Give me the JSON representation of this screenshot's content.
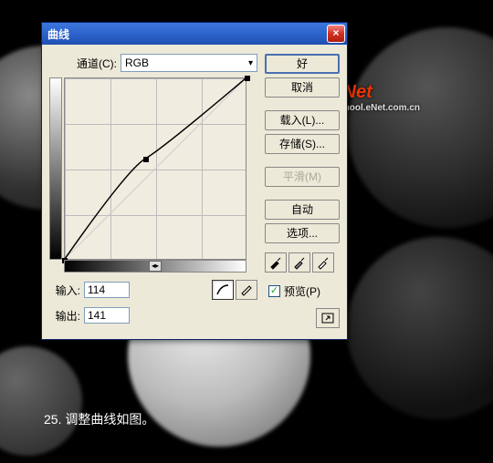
{
  "dialog": {
    "title": "曲线",
    "channel_label": "通道(C):",
    "channel_value": "RGB",
    "input_label": "输入:",
    "input_value": "114",
    "output_label": "输出:",
    "output_value": "141"
  },
  "buttons": {
    "ok": "好",
    "cancel": "取消",
    "load": "载入(L)...",
    "save": "存储(S)...",
    "smooth": "平滑(M)",
    "auto": "自动",
    "options": "选项..."
  },
  "preview": {
    "label": "预览(P)",
    "checked": true
  },
  "chart_data": {
    "type": "line",
    "title": "曲线",
    "xlabel": "输入",
    "ylabel": "输出",
    "xlim": [
      0,
      255
    ],
    "ylim": [
      0,
      255
    ],
    "points": [
      {
        "x": 0,
        "y": 0
      },
      {
        "x": 114,
        "y": 141
      },
      {
        "x": 255,
        "y": 255
      }
    ]
  },
  "watermark": {
    "brand": "eNet",
    "sub": "School.eNet.com.cn"
  },
  "caption": "25. 调整曲线如图。"
}
